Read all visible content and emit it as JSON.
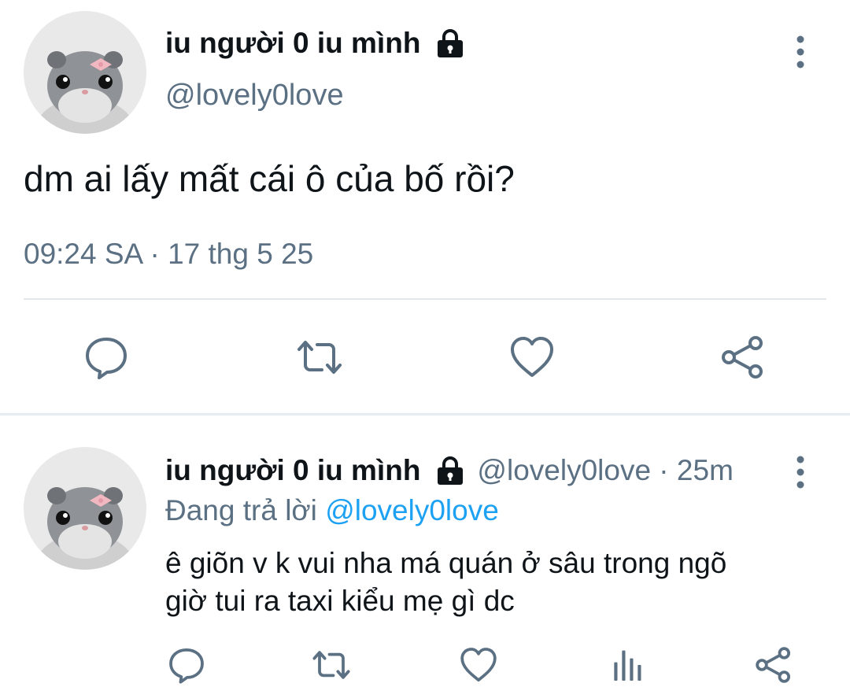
{
  "main_tweet": {
    "display_name": "iu người 0 iu mình",
    "handle": "@lovely0love",
    "text": "dm ai lấy mất cái ô của bố rồi?",
    "timestamp": "09:24 SA · 17 thg 5 25",
    "icons": [
      "lock-icon",
      "more-icon",
      "reply-icon",
      "retweet-icon",
      "like-icon",
      "share-icon"
    ]
  },
  "reply_tweet": {
    "display_name": "iu người 0 iu mình",
    "handle_time": "@lovely0love · 25m",
    "replying_label": "Đang trả lời",
    "replying_to": "@lovely0love",
    "text_line1": "ê giõn v k vui nha má quán ở sâu trong ngõ",
    "text_line2": "giờ tui ra taxi kiểu mẹ gì dc",
    "icons": [
      "lock-icon",
      "more-icon",
      "reply-icon",
      "retweet-icon",
      "like-icon",
      "analytics-icon",
      "share-icon"
    ]
  },
  "colors": {
    "text": "#0f1419",
    "secondary": "#5b7083",
    "link": "#1da1f2",
    "divider": "#e1e8ed"
  }
}
